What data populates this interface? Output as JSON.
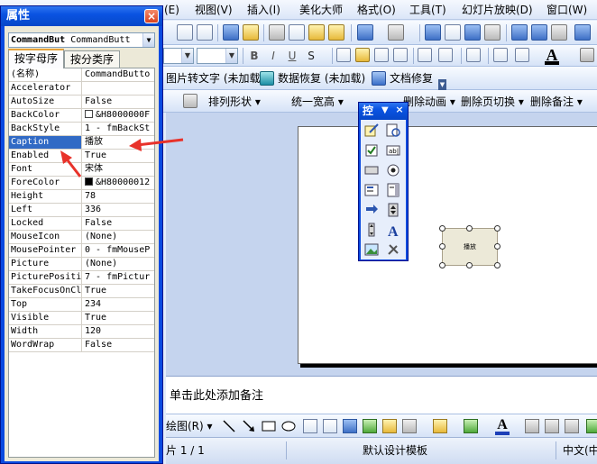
{
  "menubar": {
    "items": [
      "(E)",
      "视图(V)",
      "插入(I)",
      "美化大师",
      "格式(O)",
      "工具(T)",
      "幻灯片放映(D)",
      "窗口(W)"
    ]
  },
  "toolbar_font": {
    "font_size_value": "",
    "bold": "B",
    "italic": "I",
    "underline": "U",
    "shadow": "S",
    "font_color_letter": "A"
  },
  "addins_bar": {
    "items": [
      {
        "label": "图片转文字 (未加载)",
        "icon": "green-image-icon"
      },
      {
        "label": "数据恢复 (未加载)",
        "icon": "teal-recovery-icon"
      },
      {
        "label": "文档修复",
        "icon": "blue-repair-icon"
      }
    ]
  },
  "tools_bar": {
    "items": [
      "排列形状",
      "统一宽高",
      "删除动画",
      "删除页切换",
      "删除备注"
    ]
  },
  "properties_window": {
    "title": "属性",
    "close": "×",
    "object_name": "CommandBut",
    "object_type": "CommandButt",
    "tabs": [
      "按字母序",
      "按分类序"
    ],
    "rows": [
      {
        "name": "(名称)",
        "value": "CommandButto"
      },
      {
        "name": "Accelerator",
        "value": ""
      },
      {
        "name": "AutoSize",
        "value": "False"
      },
      {
        "name": "BackColor",
        "value": "&H8000000F",
        "swatch": "white"
      },
      {
        "name": "BackStyle",
        "value": "1 - fmBackSt"
      },
      {
        "name": "Caption",
        "value": "播放",
        "selected": true
      },
      {
        "name": "Enabled",
        "value": "True"
      },
      {
        "name": "Font",
        "value": "宋体"
      },
      {
        "name": "ForeColor",
        "value": "&H80000012",
        "swatch": "black"
      },
      {
        "name": "Height",
        "value": "78"
      },
      {
        "name": "Left",
        "value": "336"
      },
      {
        "name": "Locked",
        "value": "False"
      },
      {
        "name": "MouseIcon",
        "value": "(None)"
      },
      {
        "name": "MousePointer",
        "value": "0 - fmMouseP"
      },
      {
        "name": "Picture",
        "value": "(None)"
      },
      {
        "name": "PicturePositi",
        "value": "7 - fmPictur"
      },
      {
        "name": "TakeFocusOnCl",
        "value": "True"
      },
      {
        "name": "Top",
        "value": "234"
      },
      {
        "name": "Visible",
        "value": "True"
      },
      {
        "name": "Width",
        "value": "120"
      },
      {
        "name": "WordWrap",
        "value": "False"
      }
    ]
  },
  "toolbox": {
    "title": "控",
    "dropdown": "▼",
    "close": "×"
  },
  "slide": {
    "button_caption": "播放"
  },
  "notes": {
    "placeholder": "单击此处添加备注"
  },
  "drawing_bar": {
    "label": "绘图(R)",
    "text_a": "A"
  },
  "status_bar": {
    "slide_info": "片 1 / 1",
    "template": "默认设计模板",
    "language": "中文(中"
  },
  "colors": {
    "titlebar_blue": "#0a53e2",
    "selection": "#316ac5",
    "annotation_red": "#e8322a",
    "button_face": "#ece9d8"
  }
}
